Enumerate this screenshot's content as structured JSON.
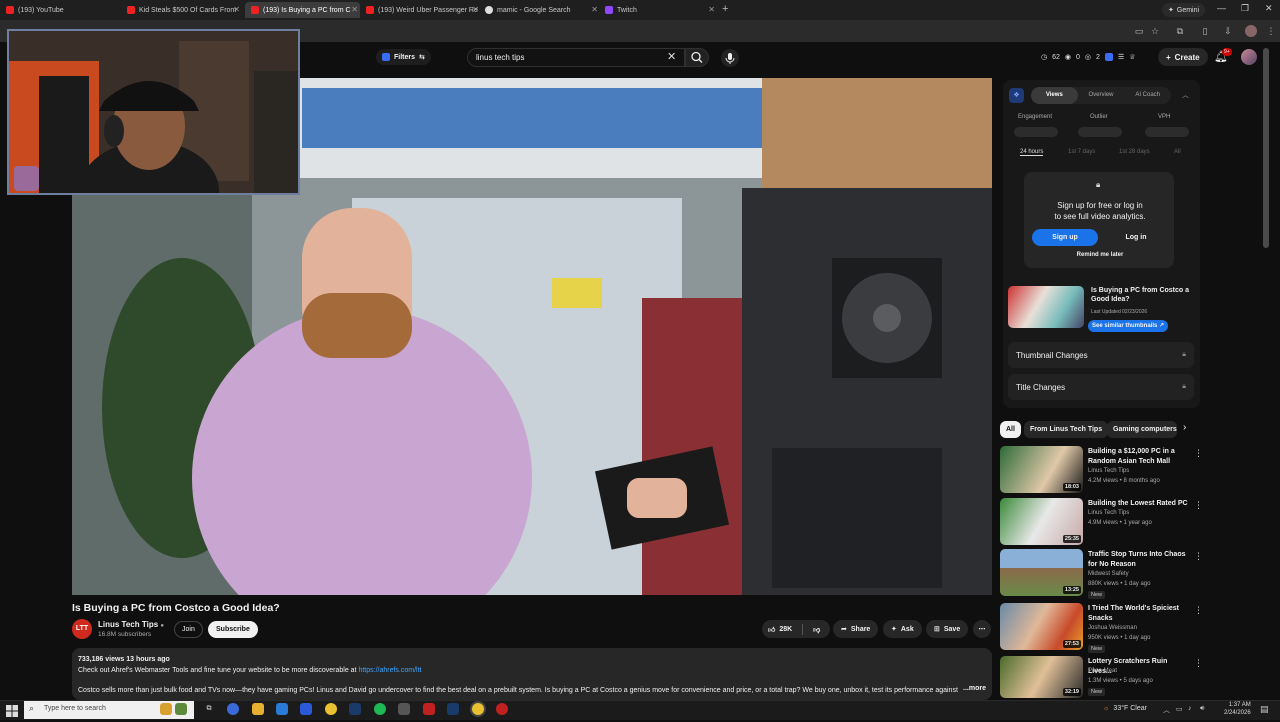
{
  "browser": {
    "tabs": [
      {
        "label": "(193) YouTube",
        "active": false
      },
      {
        "label": "Kid Steals $500 Of Cards From",
        "active": false
      },
      {
        "label": "(193) Is Buying a PC from C",
        "active": true
      },
      {
        "label": "(193) Weird Uber Passenger Re",
        "active": false
      },
      {
        "label": "mamic - Google Search",
        "active": false
      },
      {
        "label": "Twitch",
        "active": false
      }
    ],
    "new_tab": "+",
    "gemini": "Gemini",
    "controls": {
      "minimize": "—",
      "maximize": "❐",
      "close": "✕"
    }
  },
  "youtube": {
    "filters_label": "Filters",
    "search_value": "linus tech tips",
    "stats": {
      "a": "62",
      "b": "0",
      "c": "2"
    },
    "create_label": "Create",
    "notif_badge": "9+"
  },
  "video": {
    "title": "Is Buying a PC from Costco a Good Idea?",
    "channel": "Linus Tech Tips",
    "channel_avatar_text": "LTT",
    "subscribers": "16.8M subscribers",
    "join": "Join",
    "subscribe": "Subscribe",
    "likes": "28K",
    "share": "Share",
    "ask": "Ask",
    "save": "Save",
    "more": "⋯"
  },
  "description": {
    "meta": "733,186 views  13 hours ago",
    "line1": "Check out Ahref's Webmaster Tools and fine tune your website to be more discoverable at ",
    "link": "https://ahrefs.com/ltt",
    "line2": "Costco sells more than just bulk food and TVs now—they have gaming PCs! Linus and David go undercover to find the best deal on a prebuilt system. Is buying a PC at Costco a genius move for convenience and price, or a total trap? We buy one, unbox it, test its performance against a c",
    "more": "...more"
  },
  "analytics": {
    "tabs": [
      "Views",
      "Overview",
      "AI Coach"
    ],
    "labels": [
      "Engagement",
      "Outlier",
      "VPH"
    ],
    "ranges": [
      "24 hours",
      "1st 7 days",
      "1st 28 days",
      "All"
    ],
    "signup_text_1": "Sign up for free or log in",
    "signup_text_2": "to see full video analytics.",
    "signup": "Sign up",
    "login": "Log in",
    "remind": "Remind me later",
    "vid_title": "Is Buying a PC from Costco a Good Idea?",
    "vid_date": "Last Updated 02/23/2026",
    "similar": "See similar thumbnails ↗",
    "thumbnail_changes": "Thumbnail Changes",
    "title_changes": "Title Changes"
  },
  "chips": [
    "All",
    "From Linus Tech Tips",
    "Gaming computers"
  ],
  "recommendations": [
    {
      "title": "Building a $12,000 PC in a Random Asian Tech Mall",
      "channel": "Linus Tech Tips",
      "meta": "4.2M views • 8 months ago",
      "duration": "18:03",
      "new": "",
      "color": "#2d6b3a"
    },
    {
      "title": "Building the Lowest Rated PC",
      "channel": "Linus Tech Tips",
      "meta": "4.9M views • 1 year ago",
      "duration": "25:35",
      "new": "",
      "color": "#3a8a3a"
    },
    {
      "title": "Traffic Stop Turns Into Chaos for No Reason",
      "channel": "Midwest Safety",
      "meta": "880K views • 1 day ago",
      "duration": "13:25",
      "new": "New",
      "color": "#8a6a4a"
    },
    {
      "title": "I Tried The World's Spiciest Snacks",
      "channel": "Joshua Weissman",
      "meta": "950K views • 1 day ago",
      "duration": "27:53",
      "new": "New",
      "color": "#c84a2a"
    },
    {
      "title": "Lottery Scratchers Ruin Lives...",
      "channel": "Papa Meat",
      "meta": "1.3M views • 5 days ago",
      "duration": "32:19",
      "new": "New",
      "color": "#4a6a2a"
    }
  ],
  "taskbar": {
    "search_placeholder": "Type here to search",
    "weather": "33°F  Clear",
    "time": "1:37 AM",
    "date": "2/24/2026"
  },
  "colors": {
    "accent_blue": "#1a73e8",
    "yt_red": "#cc0000",
    "link": "#3ea6ff"
  }
}
